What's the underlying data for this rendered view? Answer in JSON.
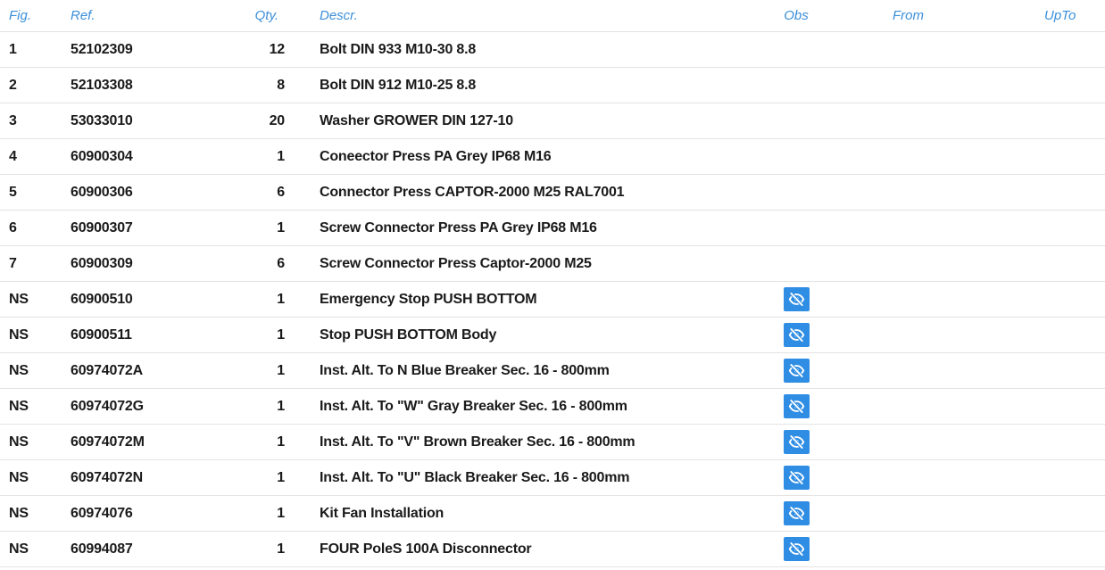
{
  "columns": {
    "fig": "Fig.",
    "ref": "Ref.",
    "qty": "Qty.",
    "descr": "Descr.",
    "obs": "Obs",
    "from": "From",
    "upto": "UpTo"
  },
  "colors": {
    "header_text": "#3b8fd9",
    "obs_button": "#2f8de4",
    "row_text": "#1a1a1a",
    "divider": "#e3e3e3"
  },
  "rows": [
    {
      "fig": "1",
      "ref": "52102309",
      "qty": "12",
      "descr": "Bolt DIN 933 M10-30 8.8",
      "obs_icon": null,
      "from": "",
      "upto": ""
    },
    {
      "fig": "2",
      "ref": "52103308",
      "qty": "8",
      "descr": "Bolt DIN 912 M10-25 8.8",
      "obs_icon": null,
      "from": "",
      "upto": ""
    },
    {
      "fig": "3",
      "ref": "53033010",
      "qty": "20",
      "descr": "Washer GROWER DIN 127-10",
      "obs_icon": null,
      "from": "",
      "upto": ""
    },
    {
      "fig": "4",
      "ref": "60900304",
      "qty": "1",
      "descr": "Coneector Press PA Grey IP68 M16",
      "obs_icon": null,
      "from": "",
      "upto": ""
    },
    {
      "fig": "5",
      "ref": "60900306",
      "qty": "6",
      "descr": "Connector Press CAPTOR-2000 M25 RAL7001",
      "obs_icon": null,
      "from": "",
      "upto": ""
    },
    {
      "fig": "6",
      "ref": "60900307",
      "qty": "1",
      "descr": "Screw Connector Press PA Grey IP68 M16",
      "obs_icon": null,
      "from": "",
      "upto": ""
    },
    {
      "fig": "7",
      "ref": "60900309",
      "qty": "6",
      "descr": "Screw Connector Press Captor-2000 M25",
      "obs_icon": null,
      "from": "",
      "upto": ""
    },
    {
      "fig": "NS",
      "ref": "60900510",
      "qty": "1",
      "descr": "Emergency Stop PUSH BOTTOM",
      "obs_icon": "eye-slash-icon",
      "from": "",
      "upto": ""
    },
    {
      "fig": "NS",
      "ref": "60900511",
      "qty": "1",
      "descr": "Stop PUSH BOTTOM Body",
      "obs_icon": "eye-slash-icon",
      "from": "",
      "upto": ""
    },
    {
      "fig": "NS",
      "ref": "60974072A",
      "qty": "1",
      "descr": "Inst. Alt. To N Blue Breaker Sec. 16 - 800mm",
      "obs_icon": "eye-slash-icon",
      "from": "",
      "upto": ""
    },
    {
      "fig": "NS",
      "ref": "60974072G",
      "qty": "1",
      "descr": "Inst. Alt. To \"W\" Gray Breaker Sec. 16 - 800mm",
      "obs_icon": "eye-slash-icon",
      "from": "",
      "upto": ""
    },
    {
      "fig": "NS",
      "ref": "60974072M",
      "qty": "1",
      "descr": "Inst. Alt. To \"V\" Brown Breaker Sec. 16 - 800mm",
      "obs_icon": "eye-slash-icon",
      "from": "",
      "upto": ""
    },
    {
      "fig": "NS",
      "ref": "60974072N",
      "qty": "1",
      "descr": "Inst. Alt. To \"U\" Black Breaker Sec. 16 - 800mm",
      "obs_icon": "eye-slash-icon",
      "from": "",
      "upto": ""
    },
    {
      "fig": "NS",
      "ref": "60974076",
      "qty": "1",
      "descr": "Kit Fan Installation",
      "obs_icon": "eye-slash-icon",
      "from": "",
      "upto": ""
    },
    {
      "fig": "NS",
      "ref": "60994087",
      "qty": "1",
      "descr": "FOUR PoleS 100A Disconnector",
      "obs_icon": "eye-slash-icon",
      "from": "",
      "upto": ""
    }
  ]
}
